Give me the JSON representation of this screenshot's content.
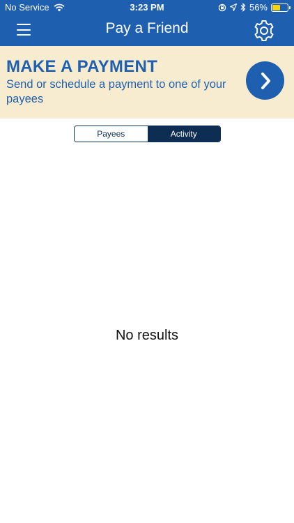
{
  "status_bar": {
    "carrier": "No Service",
    "time": "3:23 PM",
    "battery_percent": "56%",
    "battery_level": 0.56,
    "icons": [
      "wifi-icon",
      "orientation-lock-icon",
      "location-icon",
      "bluetooth-icon",
      "battery-icon"
    ]
  },
  "nav": {
    "title": "Pay a Friend",
    "menu_icon": "hamburger-menu-icon",
    "settings_icon": "gear-icon"
  },
  "banner": {
    "headline": "MAKE A PAYMENT",
    "subtext": "Send or schedule a payment to one of your payees",
    "action_icon": "chevron-right-icon"
  },
  "tabs": [
    {
      "label": "Payees",
      "active": false
    },
    {
      "label": "Activity",
      "active": true
    }
  ],
  "content": {
    "empty_message": "No results"
  },
  "colors": {
    "primary_blue": "#1f5fb0",
    "banner_bg": "#f8ecd0",
    "segment_dark": "#0e2d52",
    "battery_yellow": "#ffd400"
  }
}
